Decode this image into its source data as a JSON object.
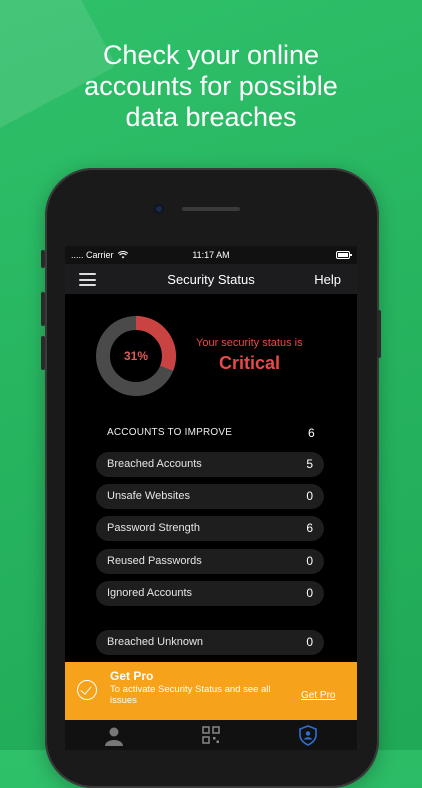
{
  "headline": {
    "line1": "Check your online",
    "line2": "accounts for possible",
    "line3": "data breaches"
  },
  "status_bar": {
    "carrier": "..... Carrier",
    "time": "11:17 AM"
  },
  "nav": {
    "title": "Security Status",
    "help": "Help"
  },
  "security": {
    "percent_label": "31%",
    "score_fraction": 0.31,
    "caption": "Your security status is",
    "status": "Critical"
  },
  "accounts": {
    "section_label": "ACCOUNTS TO IMPROVE",
    "section_count": "6",
    "items": [
      {
        "label": "Breached Accounts",
        "count": "5"
      },
      {
        "label": "Unsafe Websites",
        "count": "0"
      },
      {
        "label": "Password Strength",
        "count": "6"
      },
      {
        "label": "Reused Passwords",
        "count": "0"
      },
      {
        "label": "Ignored Accounts",
        "count": "0"
      }
    ],
    "unknown": {
      "label": "Breached Unknown",
      "count": "0"
    }
  },
  "pro": {
    "title": "Get Pro",
    "description": "To activate Security Status and see all issues",
    "link": "Get Pro"
  },
  "icons": {
    "menu": "hamburger-icon",
    "wifi": "wifi-icon",
    "battery": "battery-icon",
    "check": "check-circle-icon",
    "tab_account": "person-icon",
    "tab_scan": "qr-code-icon",
    "tab_security": "shield-icon"
  },
  "colors": {
    "background": "#27b560",
    "critical": "#e84a4a",
    "donut_track": "#4a4a4a",
    "donut_fill": "#c94343",
    "pro_banner": "#f7a21b",
    "active_tab": "#2d6fd6"
  }
}
